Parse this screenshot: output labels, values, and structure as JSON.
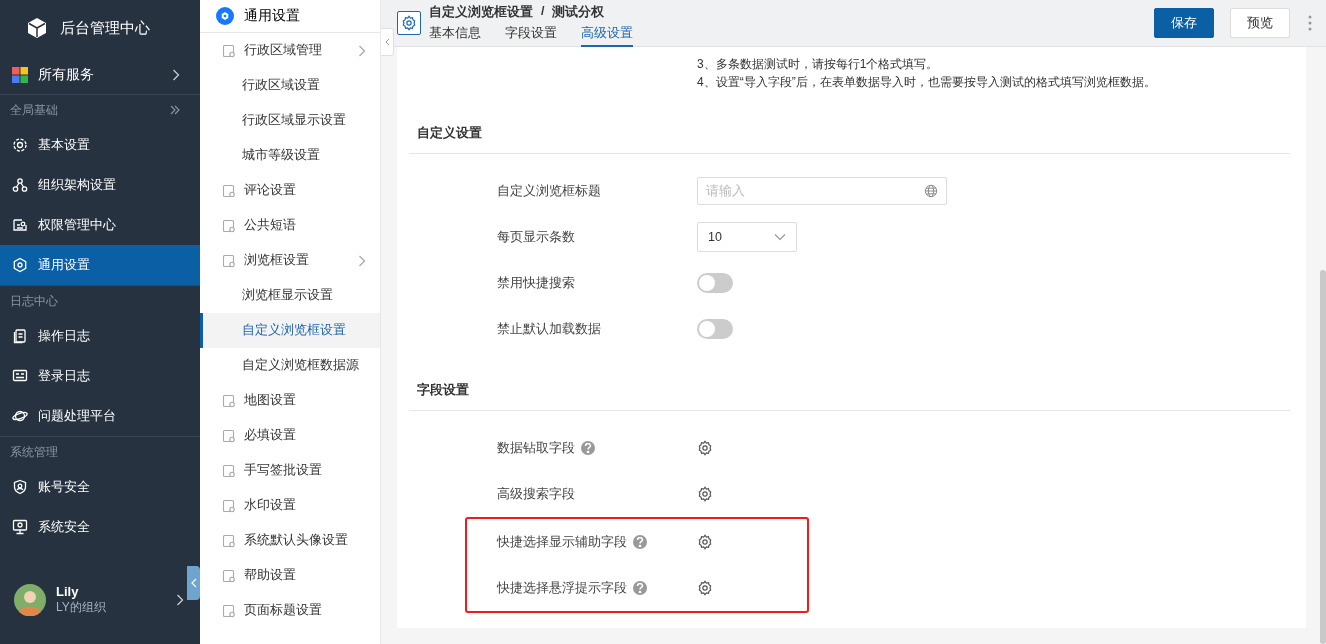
{
  "sidebar": {
    "brand": "后台管理中心",
    "services": "所有服务",
    "groups": [
      {
        "label": "全局基础",
        "items": [
          {
            "label": "基本设置",
            "selected": false
          },
          {
            "label": "组织架构设置",
            "selected": false
          },
          {
            "label": "权限管理中心",
            "selected": false
          },
          {
            "label": "通用设置",
            "selected": true
          }
        ]
      },
      {
        "label": "日志中心",
        "items": [
          {
            "label": "操作日志",
            "selected": false
          },
          {
            "label": "登录日志",
            "selected": false
          },
          {
            "label": "问题处理平台",
            "selected": false
          }
        ]
      },
      {
        "label": "系统管理",
        "items": [
          {
            "label": "账号安全",
            "selected": false
          },
          {
            "label": "系统安全",
            "selected": false
          }
        ]
      }
    ],
    "user": {
      "name": "Lily",
      "org": "LY的组织"
    }
  },
  "subnav": {
    "title": "通用设置",
    "items": [
      {
        "label": "行政区域管理",
        "selected": false,
        "children": [
          {
            "label": "行政区域设置",
            "selected": false
          },
          {
            "label": "行政区域显示设置",
            "selected": false
          },
          {
            "label": "城市等级设置",
            "selected": false
          }
        ]
      },
      {
        "label": "评论设置",
        "selected": false
      },
      {
        "label": "公共短语",
        "selected": false
      },
      {
        "label": "浏览框设置",
        "selected": false,
        "children": [
          {
            "label": "浏览框显示设置",
            "selected": false
          },
          {
            "label": "自定义浏览框设置",
            "selected": true
          },
          {
            "label": "自定义浏览框数据源",
            "selected": false
          }
        ]
      },
      {
        "label": "地图设置",
        "selected": false
      },
      {
        "label": "必填设置",
        "selected": false
      },
      {
        "label": "手写签批设置",
        "selected": false
      },
      {
        "label": "水印设置",
        "selected": false
      },
      {
        "label": "系统默认头像设置",
        "selected": false
      },
      {
        "label": "帮助设置",
        "selected": false
      },
      {
        "label": "页面标题设置",
        "selected": false
      }
    ]
  },
  "header": {
    "breadcrumb": [
      "自定义浏览框设置",
      "测试分权"
    ],
    "separator": "/",
    "tabs": [
      {
        "label": "基本信息",
        "selected": false
      },
      {
        "label": "字段设置",
        "selected": false
      },
      {
        "label": "高级设置",
        "selected": true
      }
    ],
    "buttons": [
      {
        "label": "保存",
        "kind": "primary"
      },
      {
        "label": "预览",
        "kind": "default"
      }
    ]
  },
  "notes": [
    "3、多条数据测试时，请按每行1个格式填写。",
    "4、设置“导入字段”后，在表单数据导入时，也需要按导入测试的格式填写浏览框数据。"
  ],
  "sections": [
    {
      "title": "自定义设置",
      "rows": [
        {
          "kind": "input",
          "label": "自定义浏览框标题",
          "placeholder": "请输入",
          "help": false,
          "highlighted": false
        },
        {
          "kind": "select",
          "label": "每页显示条数",
          "value": "10",
          "help": false,
          "highlighted": false
        },
        {
          "kind": "switch",
          "label": "禁用快捷搜索",
          "on": false,
          "help": false,
          "highlighted": false
        },
        {
          "kind": "switch",
          "label": "禁止默认加载数据",
          "on": false,
          "help": false,
          "highlighted": false
        }
      ]
    },
    {
      "title": "字段设置",
      "rows": [
        {
          "kind": "gear",
          "label": "数据钻取字段",
          "help": true,
          "highlighted": false
        },
        {
          "kind": "gear",
          "label": "高级搜索字段",
          "help": false,
          "highlighted": false
        },
        {
          "kind": "gear",
          "label": "快捷选择显示辅助字段",
          "help": true,
          "highlighted": true
        },
        {
          "kind": "gear",
          "label": "快捷选择悬浮提示字段",
          "help": true,
          "highlighted": true
        }
      ]
    }
  ]
}
